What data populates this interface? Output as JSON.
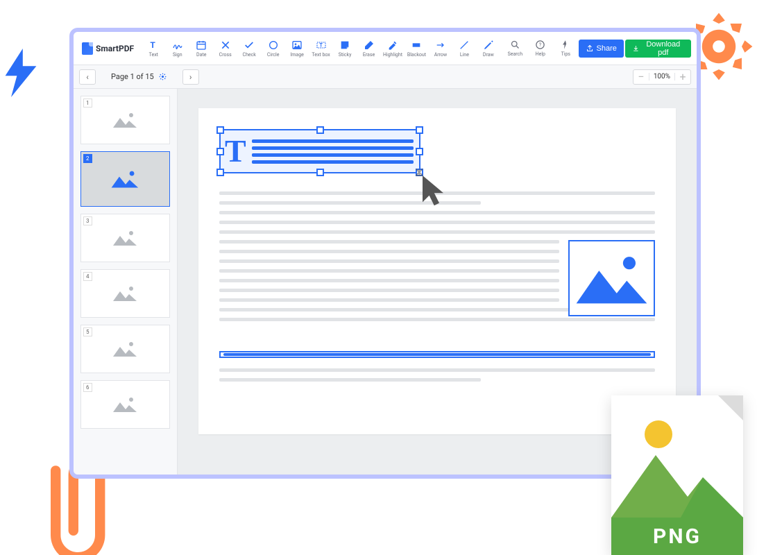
{
  "brand": "SmartPDF",
  "tools": [
    {
      "name": "text",
      "label": "Text"
    },
    {
      "name": "sign",
      "label": "Sign"
    },
    {
      "name": "date",
      "label": "Date"
    },
    {
      "name": "cross",
      "label": "Cross"
    },
    {
      "name": "check",
      "label": "Check"
    },
    {
      "name": "circle",
      "label": "Circle"
    },
    {
      "name": "image",
      "label": "Image"
    },
    {
      "name": "textbox",
      "label": "Text box"
    },
    {
      "name": "sticky",
      "label": "Sticky"
    },
    {
      "name": "erase",
      "label": "Erase"
    },
    {
      "name": "highlight",
      "label": "Highlight"
    },
    {
      "name": "blackout",
      "label": "Blackout"
    },
    {
      "name": "arrow",
      "label": "Arrow"
    },
    {
      "name": "line",
      "label": "Line"
    },
    {
      "name": "draw",
      "label": "Draw"
    }
  ],
  "utilTools": [
    {
      "name": "search",
      "label": "Search"
    },
    {
      "name": "help",
      "label": "Help"
    },
    {
      "name": "tips",
      "label": "Tips"
    }
  ],
  "shareLabel": "Share",
  "downloadLabel": "Download pdf",
  "pageIndicator": "Page 1 of 15",
  "zoomValue": "100%",
  "thumbs": [
    "1",
    "2",
    "3",
    "4",
    "5",
    "6"
  ],
  "selectedThumb": 2,
  "pngLabel": "PNG"
}
